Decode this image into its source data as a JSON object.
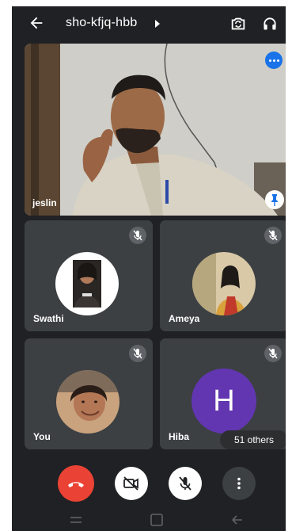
{
  "header": {
    "meeting_code": "sho-kfjq-hbb"
  },
  "featured": {
    "name": "jeslin"
  },
  "participants": [
    {
      "name": "Swathi"
    },
    {
      "name": "Ameya"
    },
    {
      "name": "You"
    },
    {
      "name": "Hiba",
      "initial": "H"
    }
  ],
  "others_label": "51 others",
  "colors": {
    "background": "#202124",
    "tile": "#3c4043",
    "end_call": "#ea4335",
    "accent": "#1a73e8",
    "avatar_hiba": "#6236b1"
  },
  "icons": [
    "back-arrow-icon",
    "caret-right-icon",
    "switch-camera-icon",
    "headphones-icon",
    "more-dots-icon",
    "pin-icon",
    "mic-off-icon",
    "end-call-icon",
    "video-off-icon",
    "more-vertical-icon"
  ]
}
